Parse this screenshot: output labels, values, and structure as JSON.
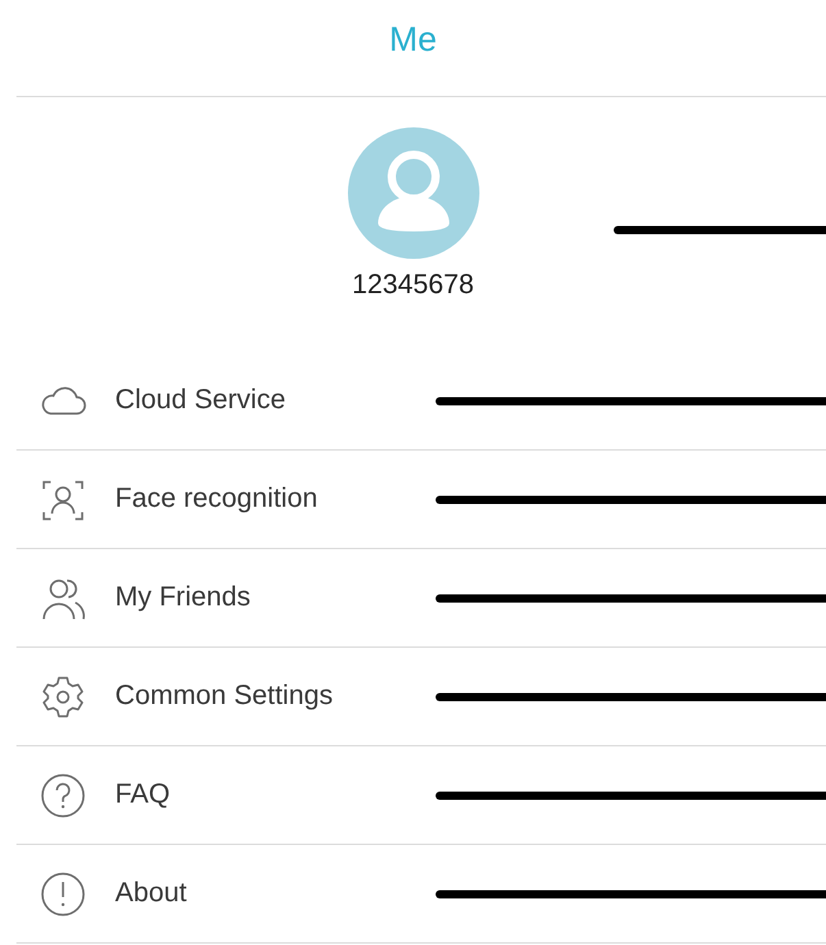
{
  "title": "Me",
  "profile": {
    "user_id": "12345678"
  },
  "menu": [
    {
      "kind": "cloud",
      "label": "Cloud Service"
    },
    {
      "kind": "face",
      "label": "Face recognition"
    },
    {
      "kind": "friends",
      "label": "My Friends"
    },
    {
      "kind": "settings",
      "label": "Common Settings"
    },
    {
      "kind": "faq",
      "label": "FAQ"
    },
    {
      "kind": "about",
      "label": "About"
    }
  ]
}
